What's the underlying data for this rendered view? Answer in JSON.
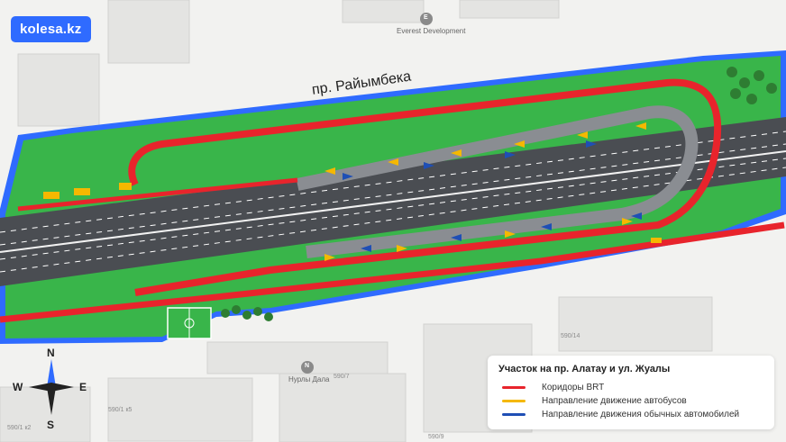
{
  "brand": {
    "logo_text": "kolesa.kz"
  },
  "map": {
    "street_label": "пр. Райымбека",
    "poi_labels": {
      "everest_icon_letter": "E",
      "everest_name": "Everest Development",
      "nurli_icon_letter": "N",
      "nurli_name": "Нурлы Дала"
    },
    "building_numbers": [
      "590/14",
      "590/7",
      "590/1 к5",
      "590/1 к2",
      "590/9"
    ]
  },
  "compass": {
    "north": "N",
    "south": "S",
    "east": "E",
    "west": "W"
  },
  "legend": {
    "title": "Участок на пр. Алатау и ул. Жуалы",
    "items": [
      {
        "label": "Коридоры BRT",
        "color": "#e8242c"
      },
      {
        "label": "Направление движение автобусов",
        "color": "#f5b800"
      },
      {
        "label": "Направление движения обычных автомобилей",
        "color": "#1f4fb5"
      }
    ]
  },
  "colors": {
    "background": "#f2f2f0",
    "road": "#4a4d52",
    "grass": "#39b54a",
    "brt": "#e8242c",
    "bus": "#f5b800",
    "car": "#1f4fb5",
    "outline": "#2f6bff"
  }
}
